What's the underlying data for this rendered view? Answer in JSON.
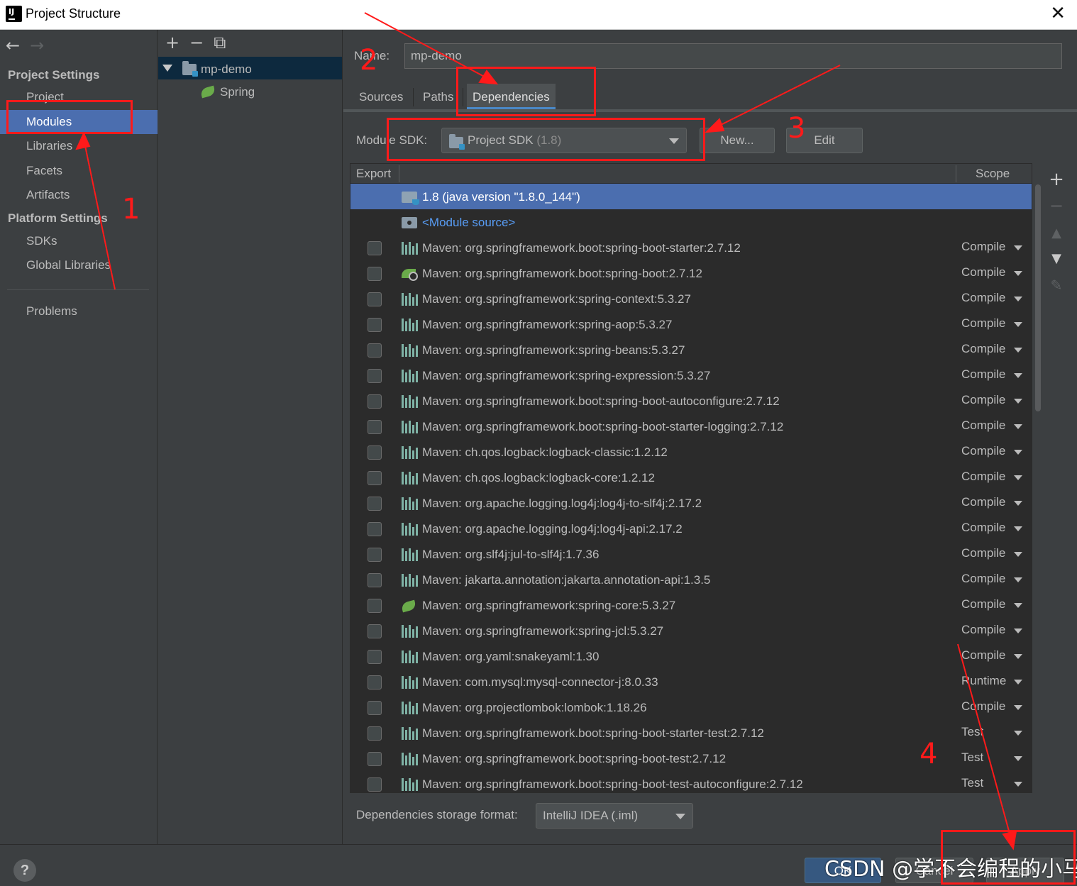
{
  "window": {
    "title": "Project Structure",
    "close_glyph": "✕"
  },
  "sidebar": {
    "back": "←",
    "forward": "→",
    "project_settings_heading": "Project Settings",
    "project_settings_items": [
      "Project",
      "Modules",
      "Libraries",
      "Facets",
      "Artifacts"
    ],
    "platform_settings_heading": "Platform Settings",
    "platform_settings_items": [
      "SDKs",
      "Global Libraries"
    ],
    "problems": "Problems",
    "selected": "Modules"
  },
  "tree": {
    "toolbar": [
      "+",
      "−",
      "⧉"
    ],
    "module_name": "mp-demo",
    "facet_name": "Spring"
  },
  "module": {
    "name_label": "Name:",
    "name_value": "mp-demo",
    "tabs": [
      "Sources",
      "Paths",
      "Dependencies"
    ],
    "active_tab": "Dependencies",
    "sdk_label": "Module SDK:",
    "sdk_value": "Project SDK",
    "sdk_version": "(1.8)",
    "new_button": "New...",
    "edit_button": "Edit"
  },
  "dependencies": {
    "columns": [
      "Export",
      "Scope"
    ],
    "sdk_row": "1.8 (java version \"1.8.0_144\")",
    "module_source_row": "<Module source>",
    "rows": [
      {
        "name": "Maven: org.springframework.boot:spring-boot-starter:2.7.12",
        "scope": "Compile",
        "icon": "maven-library-icon"
      },
      {
        "name": "Maven: org.springframework.boot:spring-boot:2.7.12",
        "scope": "Compile",
        "icon": "spring-boot-icon"
      },
      {
        "name": "Maven: org.springframework:spring-context:5.3.27",
        "scope": "Compile",
        "icon": "maven-library-icon"
      },
      {
        "name": "Maven: org.springframework:spring-aop:5.3.27",
        "scope": "Compile",
        "icon": "maven-library-icon"
      },
      {
        "name": "Maven: org.springframework:spring-beans:5.3.27",
        "scope": "Compile",
        "icon": "maven-library-icon"
      },
      {
        "name": "Maven: org.springframework:spring-expression:5.3.27",
        "scope": "Compile",
        "icon": "maven-library-icon"
      },
      {
        "name": "Maven: org.springframework.boot:spring-boot-autoconfigure:2.7.12",
        "scope": "Compile",
        "icon": "maven-library-icon"
      },
      {
        "name": "Maven: org.springframework.boot:spring-boot-starter-logging:2.7.12",
        "scope": "Compile",
        "icon": "maven-library-icon"
      },
      {
        "name": "Maven: ch.qos.logback:logback-classic:1.2.12",
        "scope": "Compile",
        "icon": "maven-library-icon"
      },
      {
        "name": "Maven: ch.qos.logback:logback-core:1.2.12",
        "scope": "Compile",
        "icon": "maven-library-icon"
      },
      {
        "name": "Maven: org.apache.logging.log4j:log4j-to-slf4j:2.17.2",
        "scope": "Compile",
        "icon": "maven-library-icon"
      },
      {
        "name": "Maven: org.apache.logging.log4j:log4j-api:2.17.2",
        "scope": "Compile",
        "icon": "maven-library-icon"
      },
      {
        "name": "Maven: org.slf4j:jul-to-slf4j:1.7.36",
        "scope": "Compile",
        "icon": "maven-library-icon"
      },
      {
        "name": "Maven: jakarta.annotation:jakarta.annotation-api:1.3.5",
        "scope": "Compile",
        "icon": "maven-library-icon"
      },
      {
        "name": "Maven: org.springframework:spring-core:5.3.27",
        "scope": "Compile",
        "icon": "spring-icon"
      },
      {
        "name": "Maven: org.springframework:spring-jcl:5.3.27",
        "scope": "Compile",
        "icon": "maven-library-icon"
      },
      {
        "name": "Maven: org.yaml:snakeyaml:1.30",
        "scope": "Compile",
        "icon": "maven-library-icon"
      },
      {
        "name": "Maven: com.mysql:mysql-connector-j:8.0.33",
        "scope": "Runtime",
        "icon": "maven-library-icon"
      },
      {
        "name": "Maven: org.projectlombok:lombok:1.18.26",
        "scope": "Compile",
        "icon": "maven-library-icon"
      },
      {
        "name": "Maven: org.springframework.boot:spring-boot-starter-test:2.7.12",
        "scope": "Test",
        "icon": "maven-library-icon"
      },
      {
        "name": "Maven: org.springframework.boot:spring-boot-test:2.7.12",
        "scope": "Test",
        "icon": "maven-library-icon"
      },
      {
        "name": "Maven: org.springframework.boot:spring-boot-test-autoconfigure:2.7.12",
        "scope": "Test",
        "icon": "maven-library-icon"
      }
    ],
    "side_tools": [
      "+",
      "−",
      "▲",
      "▼",
      "✎"
    ],
    "storage_label": "Dependencies storage format:",
    "storage_value": "IntelliJ IDEA (.iml)"
  },
  "footer": {
    "help": "?",
    "ok": "OK",
    "cancel": "Cancel",
    "apply": "Apply"
  },
  "watermark": "CSDN @学不会编程的小马",
  "annotations": {
    "marker_color": "#ff1a1a",
    "numbers": [
      "1",
      "2",
      "3",
      "4"
    ]
  },
  "colors": {
    "selection": "#4b6eaf",
    "link": "#589df6",
    "background": "#3c3f41",
    "table_background": "#2b2b2b",
    "ok_button": "#365880"
  }
}
